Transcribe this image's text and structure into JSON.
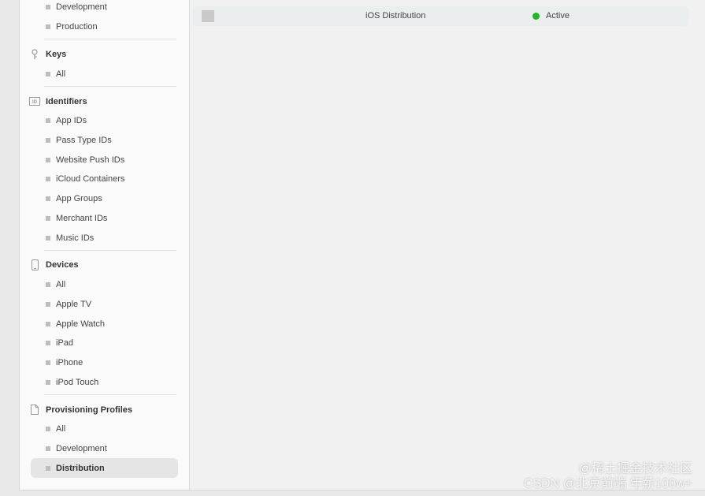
{
  "sidebar": {
    "certificates": {
      "items": [
        {
          "label": "Development"
        },
        {
          "label": "Production"
        }
      ]
    },
    "keys": {
      "title": "Keys",
      "items": [
        {
          "label": "All"
        }
      ]
    },
    "identifiers": {
      "title": "Identifiers",
      "items": [
        {
          "label": "App IDs"
        },
        {
          "label": "Pass Type IDs"
        },
        {
          "label": "Website Push IDs"
        },
        {
          "label": "iCloud Containers"
        },
        {
          "label": "App Groups"
        },
        {
          "label": "Merchant IDs"
        },
        {
          "label": "Music IDs"
        }
      ]
    },
    "devices": {
      "title": "Devices",
      "items": [
        {
          "label": "All"
        },
        {
          "label": "Apple TV"
        },
        {
          "label": "Apple Watch"
        },
        {
          "label": "iPad"
        },
        {
          "label": "iPhone"
        },
        {
          "label": "iPod Touch"
        }
      ]
    },
    "profiles": {
      "title": "Provisioning Profiles",
      "items": [
        {
          "label": "All"
        },
        {
          "label": "Development"
        },
        {
          "label": "Distribution",
          "selected": true
        }
      ]
    }
  },
  "main": {
    "rows": [
      {
        "name": "iOS Distribution",
        "status": "Active",
        "status_color": "#28b428"
      }
    ]
  },
  "watermark": {
    "line1": "@稀土掘金技术社区",
    "line2": "CSDN @北京前端 年薪100w+"
  }
}
